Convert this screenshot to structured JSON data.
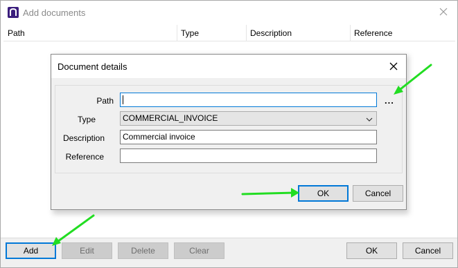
{
  "window": {
    "title": "Add documents"
  },
  "grid": {
    "columns": [
      "Path",
      "Type",
      "Description",
      "Reference"
    ]
  },
  "bottom_buttons": {
    "add": "Add",
    "edit": "Edit",
    "delete": "Delete",
    "clear": "Clear",
    "ok": "OK",
    "cancel": "Cancel"
  },
  "dialog": {
    "title": "Document details",
    "labels": {
      "path": "Path",
      "type": "Type",
      "description": "Description",
      "reference": "Reference"
    },
    "values": {
      "path": "",
      "type": "COMMERCIAL_INVOICE",
      "description": "Commercial invoice",
      "reference": ""
    },
    "browse_label": "...",
    "ok": "OK",
    "cancel": "Cancel"
  },
  "colors": {
    "accent": "#0078d7",
    "annotation_arrow": "#22dd22",
    "app_icon": "#3b1e7d"
  },
  "icons": [
    "app-icon",
    "close-icon",
    "chevron-down-icon"
  ]
}
